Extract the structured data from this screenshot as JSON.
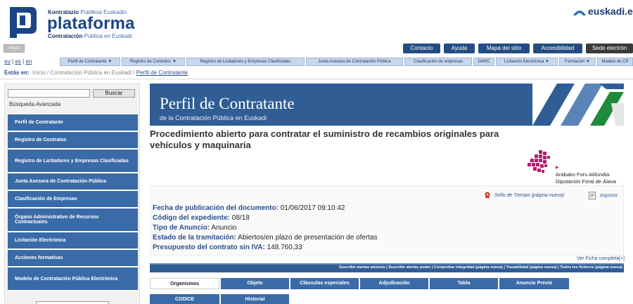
{
  "header": {
    "brand_top_bold": "Kontratazio",
    "brand_top_light": "Publikoa Euskadin",
    "brand_main": "plataforma",
    "brand_sub_bold": "Contratación",
    "brand_sub_light": "Pública en Euskadi",
    "euskadi": "euskadi.e"
  },
  "topbar": {
    "mini_button": "Inicio",
    "nav": [
      "Contacto",
      "Ayuda",
      "Mapa del sitio",
      "Accesibilidad",
      "Sede electrón"
    ]
  },
  "languages": [
    "eu",
    "es",
    "en"
  ],
  "menu": [
    "Perfil de Contratante ▼",
    "Registro de Contratos ▼",
    "Registro de Licitadores y Empresas Clasificadas",
    "Junta Asesora de Contratación Pública",
    "Clasificación de empresas",
    "OARC",
    "Licitación Electrónica ▼",
    "Formación ▼",
    "Modelo de CP"
  ],
  "breadcrumb": {
    "label": "Estás en:",
    "items": [
      "Inicio",
      "/",
      "Contratación Pública en Euskadi",
      "/"
    ],
    "current": "Perfil de Contratante"
  },
  "sidebar": {
    "search_button": "Buscar",
    "advanced": "Búsqueda Avanzada",
    "items": [
      "Perfil de Contratante",
      "Registro de Contratos",
      "Registro de Licitadores y Empresas Clasificadas",
      "Junta Asesora de Contratación Pública",
      "Clasificación de Empresas",
      "Órgano Administrativo de Recursos Contractuales",
      "Licitación Electrónica",
      "Acciones formativas",
      "Modelo de Contratación Pública Electrónica"
    ]
  },
  "banner": {
    "title": "Perfil de Contratante",
    "subtitle": "de la Contratación Pública en Euskadi"
  },
  "procedure": {
    "title": "Procedimiento abierto para contratar el suministro de recambios originales para vehículos y maquinaria",
    "org_line1": "Arabako Foru Aldundia",
    "org_line2": "Diputación Foral de Álava",
    "sello": "Sello de Tiempo (página nueva)",
    "imprimir": "Imprimir",
    "fields": [
      {
        "k": "Fecha de publicación del documento:",
        "v": "01/06/2017 09:10:42"
      },
      {
        "k": "Código del expediente:",
        "v": "08/18"
      },
      {
        "k": "Tipo de Anuncio:",
        "v": "Anuncio"
      },
      {
        "k": "Estado de la tramitación:",
        "v": "Abiertos/en plazo de presentación de ofertas"
      },
      {
        "k": "Presupuesto del contrato sin IVA:",
        "v": "148.760,33"
      }
    ],
    "ficha": "Ver Ficha completa[+]",
    "action_links": "Suscribir alertas anuncio | Suscribir alertas poder | Comprobar integridad (página nueva) | Trazabilidad (página nueva) | Todos los ficheros (página nueva)"
  },
  "tabs": {
    "row1": [
      "Organismos",
      "Objeto",
      "Cláusulas especiales",
      "Adjudicación",
      "Tabla",
      "Anuncio Previo"
    ],
    "row2": [
      "CODICE",
      "Historial"
    ]
  },
  "colors": {
    "primary": "#2f5d94",
    "nav": "#3a6aa8",
    "accent": "#b01c6c"
  }
}
